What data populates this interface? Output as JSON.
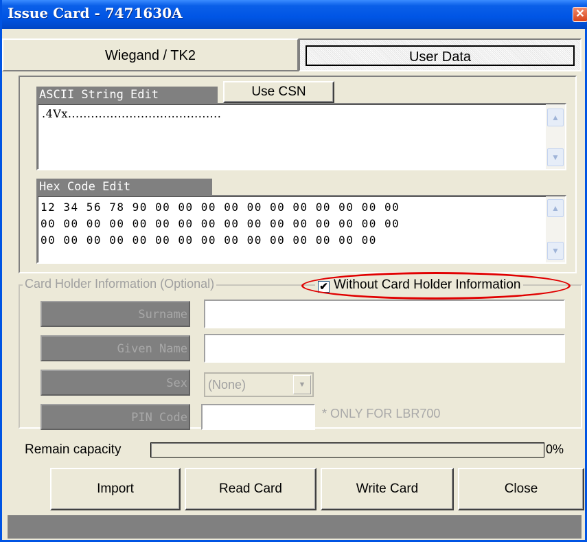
{
  "window": {
    "title": "Issue Card - 7471630A",
    "close_glyph": "✕"
  },
  "tabs": [
    {
      "label": "Wiegand / TK2"
    },
    {
      "label": "User Data"
    }
  ],
  "ascii": {
    "label": "ASCII String Edit",
    "use_csn_label": "Use CSN",
    "value": ".4Vx........................................"
  },
  "hex": {
    "label": "Hex Code Edit",
    "lines": [
      "12 34 56 78 90 00 00 00 00 00 00 00 00 00 00 00",
      "00 00 00 00 00 00 00 00 00 00 00 00 00 00 00 00",
      "00 00 00 00 00 00 00 00 00 00 00 00 00 00 00"
    ]
  },
  "card_holder": {
    "legend": "Card Holder Information (Optional)",
    "without_checkbox_label": "Without Card Holder Information",
    "without_checked": true,
    "fields": {
      "surname_label": "Surname",
      "surname_value": "",
      "given_name_label": "Given Name",
      "given_name_value": "",
      "sex_label": "Sex",
      "sex_value": "(None)",
      "pin_label": "PIN Code",
      "pin_value": ""
    },
    "pin_note": "* ONLY FOR LBR700"
  },
  "capacity": {
    "label": "Remain capacity",
    "percent_text": "0%",
    "fraction": 0
  },
  "actions": {
    "import_label": "Import",
    "read_label": "Read Card",
    "write_label": "Write Card",
    "close_label": "Close"
  },
  "colors": {
    "title_bar": "#0055e5",
    "annotation_ellipse": "#e00000",
    "disabled_text": "#a0a0a0"
  }
}
